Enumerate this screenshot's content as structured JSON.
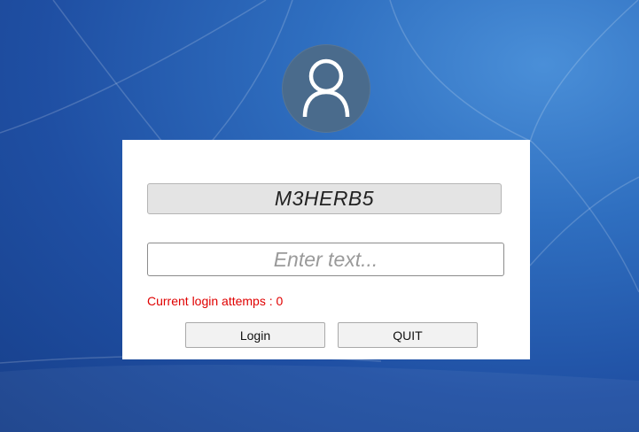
{
  "avatar": {
    "icon": "user-icon"
  },
  "login_panel": {
    "code_value": "M3HERB5",
    "input": {
      "placeholder": "Enter text...",
      "value": ""
    },
    "attempts_text": "Current login attemps : 0",
    "login_label": "Login",
    "quit_label": "QUIT"
  },
  "colors": {
    "wallpaper": "#2a5fb3",
    "avatar_bg": "#4a6b8c",
    "attempts_text": "#e00000",
    "panel_bg": "#ffffff"
  }
}
